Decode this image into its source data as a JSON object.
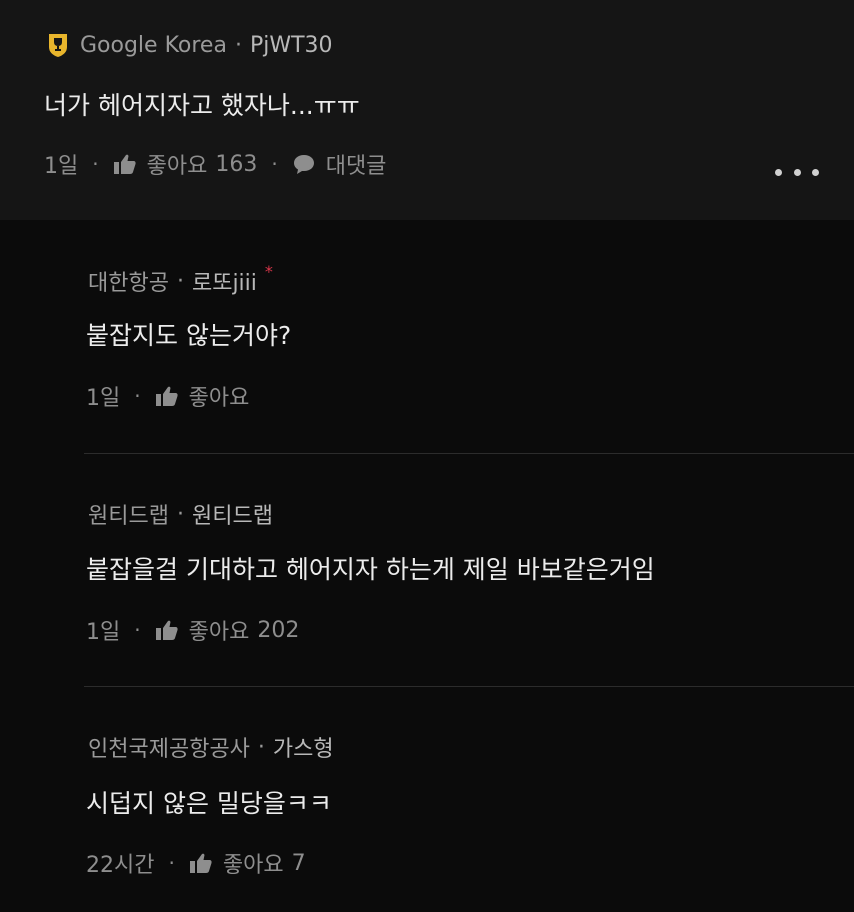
{
  "top_comment": {
    "company": "Google Korea",
    "nickname": "PjWT30",
    "body": "너가 헤어지자고 했자나...ㅠㅠ",
    "age": "1일",
    "like_label": "좋아요",
    "like_count": "163",
    "reply_label": "대댓글",
    "badge_icon": "trophy-badge-icon",
    "badge_color": "#e8b52c"
  },
  "replies": [
    {
      "company": "대한항공",
      "nickname": "로또jiii",
      "body": "붙잡지도 않는거야?",
      "age": "1일",
      "like_label": "좋아요",
      "like_count": ""
    },
    {
      "company": "원티드랩",
      "nickname": "원티드랩",
      "body": "붙잡을걸 기대하고 헤어지자 하는게 제일 바보같은거임",
      "age": "1일",
      "like_label": "좋아요",
      "like_count": "202"
    },
    {
      "company": "인천국제공항공사",
      "nickname": "가스형",
      "body": "시덥지 않은 밀당을ㅋㅋ",
      "age": "22시간",
      "like_label": "좋아요",
      "like_count": "7"
    }
  ],
  "colors": {
    "background": "#0b0b0b",
    "top_comment_bg": "#151515",
    "author_star": "#d9364a"
  }
}
